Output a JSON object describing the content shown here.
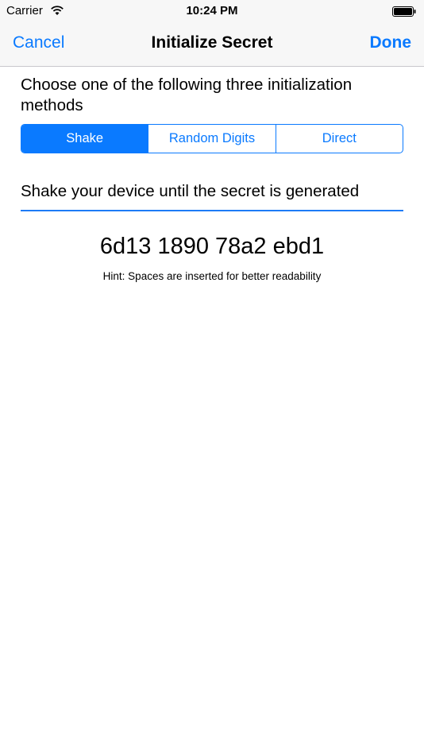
{
  "status_bar": {
    "carrier": "Carrier",
    "time": "10:24 PM",
    "wifi_icon": "wifi-icon",
    "battery_icon": "battery-icon"
  },
  "nav": {
    "cancel_label": "Cancel",
    "title": "Initialize Secret",
    "done_label": "Done"
  },
  "content": {
    "instruction": "Choose one of the following three initialization methods",
    "segments": [
      {
        "label": "Shake",
        "selected": true
      },
      {
        "label": "Random Digits",
        "selected": false
      },
      {
        "label": "Direct",
        "selected": false
      }
    ],
    "method_description": "Shake your device until the secret is generated",
    "secret": "6d13 1890 78a2 ebd1",
    "hint": "Hint: Spaces are inserted for better readability"
  },
  "colors": {
    "accent": "#0a7aff",
    "bar_background": "#f7f7f7"
  }
}
